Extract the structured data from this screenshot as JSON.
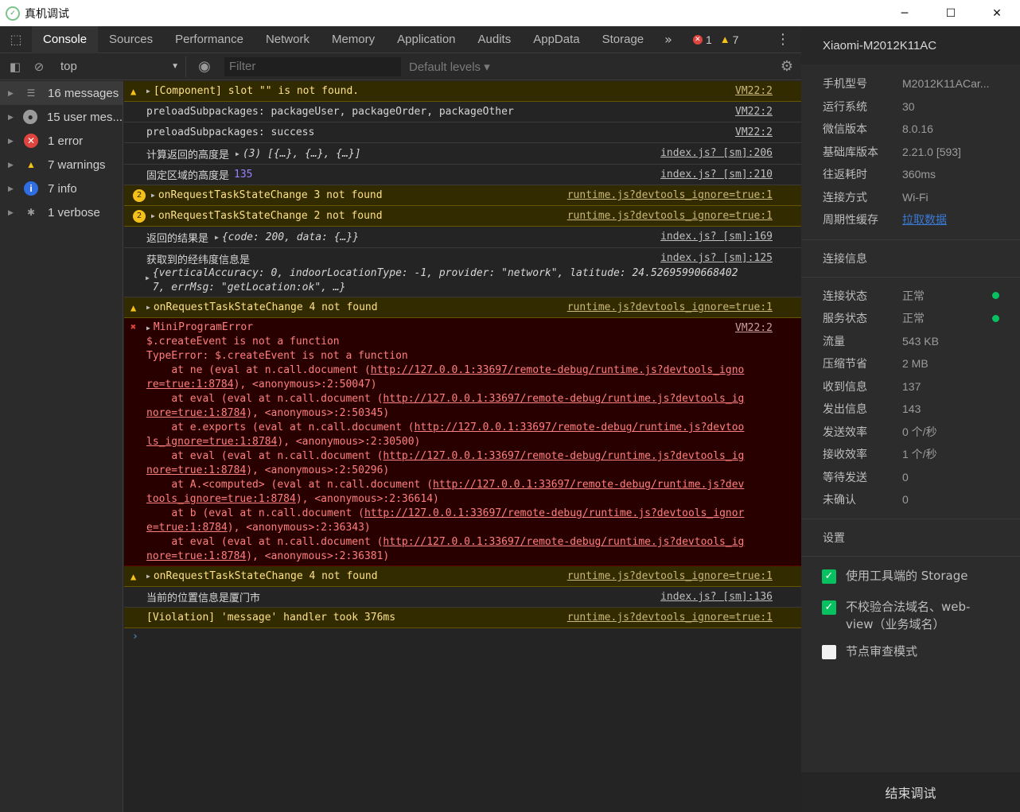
{
  "window": {
    "title": "真机调试",
    "min": "─",
    "max": "☐",
    "close": "✕"
  },
  "tabs": [
    "Console",
    "Sources",
    "Performance",
    "Network",
    "Memory",
    "Application",
    "Audits",
    "AppData",
    "Storage"
  ],
  "tab_overflow": "»",
  "counts": {
    "errors": "1",
    "warnings": "7"
  },
  "toolbar": {
    "context": "top",
    "filter_placeholder": "Filter",
    "levels": "Default levels ▾"
  },
  "sidebar": [
    {
      "label": "16 messages",
      "icon": "list-icon",
      "glyph": "☰"
    },
    {
      "label": "15 user mes...",
      "icon": "user-icon",
      "glyph": "●"
    },
    {
      "label": "1 error",
      "icon": "error-icon",
      "glyph": "✕"
    },
    {
      "label": "7 warnings",
      "icon": "warning-icon",
      "glyph": "▲"
    },
    {
      "label": "7 info",
      "icon": "info-icon",
      "glyph": "i"
    },
    {
      "label": "1 verbose",
      "icon": "bug-icon",
      "glyph": "✱"
    }
  ],
  "console": {
    "r1": {
      "text": "[Component] slot \"\" is not found.",
      "src": "VM22:2"
    },
    "r2": {
      "text": "preloadSubpackages: packageUser, packageOrder, packageOther",
      "src": "VM22:2"
    },
    "r3": {
      "text": "preloadSubpackages: success",
      "src": "VM22:2"
    },
    "r4": {
      "label": "计算返回的高度是",
      "value": "(3) [{…}, {…}, {…}]",
      "src": "index.js? [sm]:206"
    },
    "r5": {
      "label": "固定区域的高度是",
      "value": "135",
      "src": "index.js? [sm]:210"
    },
    "r6": {
      "count": "2",
      "text": "onRequestTaskStateChange 3 not found",
      "src": "runtime.js?devtools_ignore=true:1"
    },
    "r7": {
      "count": "2",
      "text": "onRequestTaskStateChange 2 not found",
      "src": "runtime.js?devtools_ignore=true:1"
    },
    "r8": {
      "label": "返回的结果是",
      "value": "{code: 200, data: {…}}",
      "src": "index.js? [sm]:169"
    },
    "r9": {
      "label": "获取到的经纬度信息是",
      "line1": "{verticalAccuracy: 0, indoorLocationType: -1, provider: \"network\", latitude: 24.52695990668402",
      "line2": "7, errMsg: \"getLocation:ok\", …}",
      "src": "index.js? [sm]:125"
    },
    "r10": {
      "text": "onRequestTaskStateChange 4 not found",
      "src": "runtime.js?devtools_ignore=true:1"
    },
    "r11": {
      "title": "MiniProgramError",
      "src": "VM22:2",
      "lines": [
        "$.createEvent is not a function",
        "TypeError: $.createEvent is not a function",
        "    at ne (eval at n.call.document (http://127.0.0.1:33697/remote-debug/runtime.js?devtools_igno",
        "re=true:1:8784), <anonymous>:2:50047)",
        "    at eval (eval at n.call.document (http://127.0.0.1:33697/remote-debug/runtime.js?devtools_ig",
        "nore=true:1:8784), <anonymous>:2:50345)",
        "    at e.exports (eval at n.call.document (http://127.0.0.1:33697/remote-debug/runtime.js?devtoo",
        "ls_ignore=true:1:8784), <anonymous>:2:30500)",
        "    at eval (eval at n.call.document (http://127.0.0.1:33697/remote-debug/runtime.js?devtools_ig",
        "nore=true:1:8784), <anonymous>:2:50296)",
        "    at A.<computed> (eval at n.call.document (http://127.0.0.1:33697/remote-debug/runtime.js?dev",
        "tools_ignore=true:1:8784), <anonymous>:2:36614)",
        "    at b (eval at n.call.document (http://127.0.0.1:33697/remote-debug/runtime.js?devtools_ignor",
        "e=true:1:8784), <anonymous>:2:36343)",
        "    at eval (eval at n.call.document (http://127.0.0.1:33697/remote-debug/runtime.js?devtools_ig",
        "nore=true:1:8784), <anonymous>:2:36381)"
      ]
    },
    "r12": {
      "text": "onRequestTaskStateChange 4 not found",
      "src": "runtime.js?devtools_ignore=true:1"
    },
    "r13": {
      "text": "当前的位置信息是厦门市",
      "src": "index.js? [sm]:136"
    },
    "r14": {
      "text": "[Violation] 'message' handler took 376ms",
      "src": "runtime.js?devtools_ignore=true:1"
    },
    "prompt": "›"
  },
  "panel": {
    "device": "Xiaomi-M2012K11AC",
    "info": [
      {
        "k": "手机型号",
        "v": "M2012K11ACar..."
      },
      {
        "k": "运行系统",
        "v": "30"
      },
      {
        "k": "微信版本",
        "v": "8.0.16"
      },
      {
        "k": "基础库版本",
        "v": "2.21.0 [593]"
      },
      {
        "k": "往返耗时",
        "v": "360ms"
      },
      {
        "k": "连接方式",
        "v": "Wi-Fi"
      },
      {
        "k": "周期性缓存",
        "v": "拉取数据"
      }
    ],
    "conn_title": "连接信息",
    "conn": [
      {
        "k": "连接状态",
        "v": "正常"
      },
      {
        "k": "服务状态",
        "v": "正常"
      },
      {
        "k": "流量",
        "v": "543 KB"
      },
      {
        "k": "压缩节省",
        "v": "2 MB"
      },
      {
        "k": "收到信息",
        "v": "137"
      },
      {
        "k": "发出信息",
        "v": "143"
      },
      {
        "k": "发送效率",
        "v": "0 个/秒"
      },
      {
        "k": "接收效率",
        "v": "1 个/秒"
      },
      {
        "k": "等待发送",
        "v": "0"
      },
      {
        "k": "未确认",
        "v": "0"
      }
    ],
    "settings_title": "设置",
    "settings": [
      {
        "label": "使用工具端的 Storage",
        "checked": true
      },
      {
        "label": "不校验合法域名、web-view（业务域名）",
        "checked": true
      },
      {
        "label": "节点审查模式",
        "checked": false
      }
    ],
    "end_button": "结束调试",
    "status_color": "#07c160"
  }
}
